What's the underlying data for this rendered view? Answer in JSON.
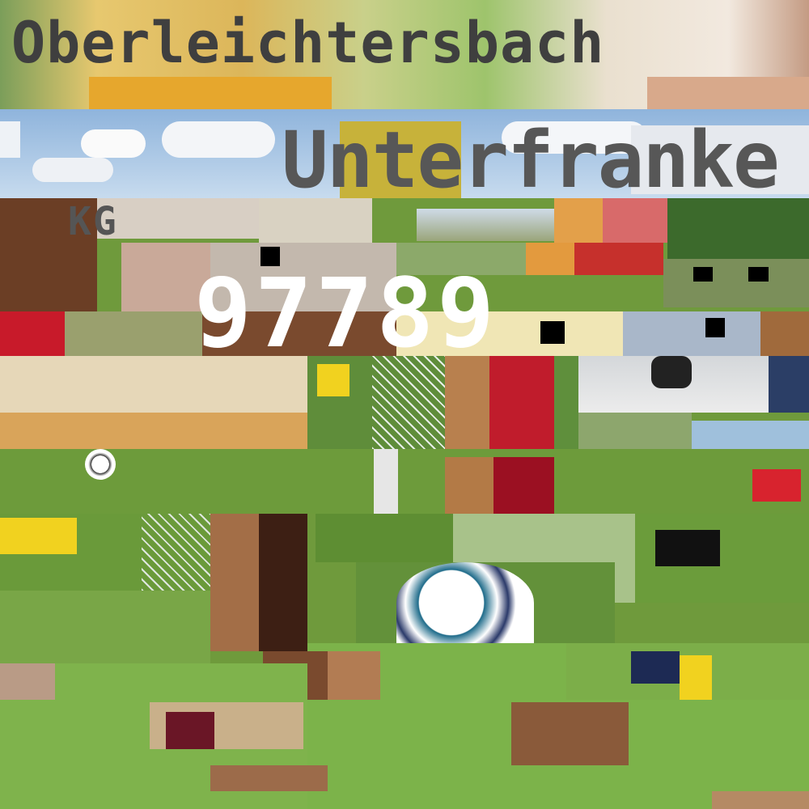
{
  "texts": {
    "title": "Oberleichtersbach",
    "region": "Unterfranke",
    "kg": "KG",
    "postal_code": "97789"
  },
  "palette": {
    "sky": "#a9c6e3",
    "grass": "#6fa03a",
    "yellow_kit": "#f1d21f",
    "red_kit": "#c8102e",
    "table_wood": "#d9a45a"
  }
}
